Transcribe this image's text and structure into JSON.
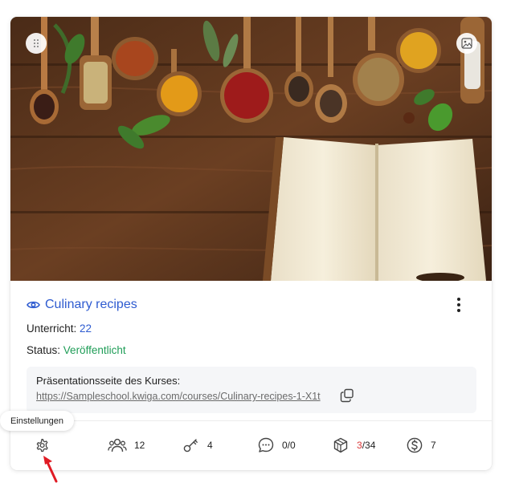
{
  "course": {
    "title": "Culinary recipes",
    "lessons_label": "Unterricht:",
    "lessons_value": "22",
    "status_label": "Status:",
    "status_value": "Veröffentlicht",
    "presentation_label": "Präsentationsseite des Kurses:",
    "presentation_url": "https://Sampleschool.kwiga.com/courses/Culinary-recipes-1-X1t"
  },
  "tooltip": {
    "text": "Einstellungen"
  },
  "stats": {
    "students": "12",
    "keys": "4",
    "comments": "0/0",
    "modules_done": "3",
    "modules_total": "/34",
    "sales": "7"
  },
  "colors": {
    "accent": "#2e5bd0",
    "published": "#1f9d57",
    "highlight": "#d93838",
    "arrow": "#e01b24"
  },
  "icons": [
    "drag-handle-icon",
    "image-icon",
    "eye-icon",
    "more-vertical-icon",
    "copy-icon",
    "gear-icon",
    "users-icon",
    "key-icon",
    "comment-icon",
    "cube-icon",
    "dollar-icon"
  ]
}
